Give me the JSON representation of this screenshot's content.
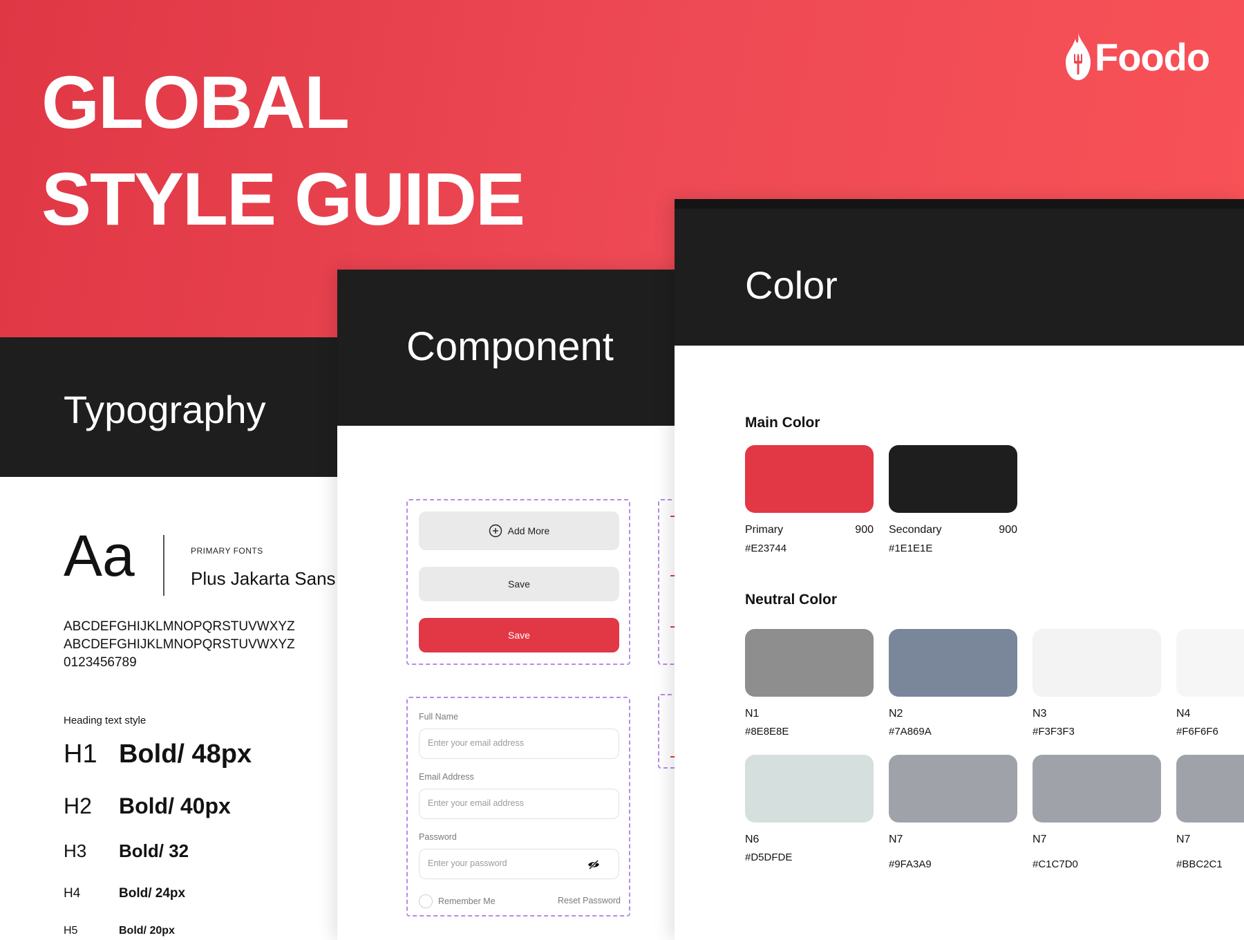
{
  "hero": {
    "title": "GLOBAL STYLE GUIDE",
    "brand": "Foodo",
    "background": "#E23744"
  },
  "typography": {
    "title": "Typography",
    "sample": "Aa",
    "primary_fonts_label": "PRIMARY FONTS",
    "font_name": "Plus Jakarta Sans",
    "alphabet": [
      "ABCDEFGHIJKLMNOPQRSTUVWXYZ",
      "ABCDEFGHIJKLMNOPQRSTUVWXYZ",
      "0123456789"
    ],
    "heading_label": "Heading text style",
    "headings": [
      {
        "tag": "H1",
        "spec": "Bold/ 48px"
      },
      {
        "tag": "H2",
        "spec": "Bold/ 40px"
      },
      {
        "tag": "H3",
        "spec": "Bold/ 32"
      },
      {
        "tag": "H4",
        "spec": "Bold/ 24px"
      },
      {
        "tag": "H5",
        "spec": "Bold/ 20px"
      }
    ]
  },
  "component": {
    "title": "Component",
    "buttons": {
      "add_more": "Add More",
      "save_grey": "Save",
      "save_red": "Save"
    },
    "form": {
      "full_name_label": "Full Name",
      "full_name_placeholder": "Enter your email address",
      "email_label": "Email Address",
      "email_placeholder": "Enter your email address",
      "password_label": "Password",
      "password_placeholder": "Enter your password",
      "remember": "Remember Me",
      "reset": "Reset Password"
    }
  },
  "color": {
    "title": "Color",
    "main_title": "Main Color",
    "main": [
      {
        "name": "Primary",
        "weight": "900",
        "hex": "#E23744",
        "color": "#E23744"
      },
      {
        "name": "Secondary",
        "weight": "900",
        "hex": "#1E1E1E",
        "color": "#1E1E1E"
      }
    ],
    "neutral_title": "Neutral Color",
    "neutral": [
      {
        "name": "N1",
        "hex": "#8E8E8E",
        "color": "#8E8E8E"
      },
      {
        "name": "N2",
        "hex": "#7A869A",
        "color": "#7A869A"
      },
      {
        "name": "N3",
        "hex": "#F3F3F3",
        "color": "#F3F3F3"
      },
      {
        "name": "N4",
        "hex": "#F6F6F6",
        "color": "#F6F6F6"
      },
      {
        "name": "N6",
        "hex": "#D5DFDE",
        "color": "#D5DFDE"
      },
      {
        "name": "N7",
        "hex": "#9FA3A9",
        "color": "#9FA3A9"
      },
      {
        "name": "N7",
        "hex": "#C1C7D0",
        "color": "#9FA3A9"
      },
      {
        "name": "N7",
        "hex": "#BBC2C1",
        "color": "#9FA3A9"
      }
    ]
  }
}
